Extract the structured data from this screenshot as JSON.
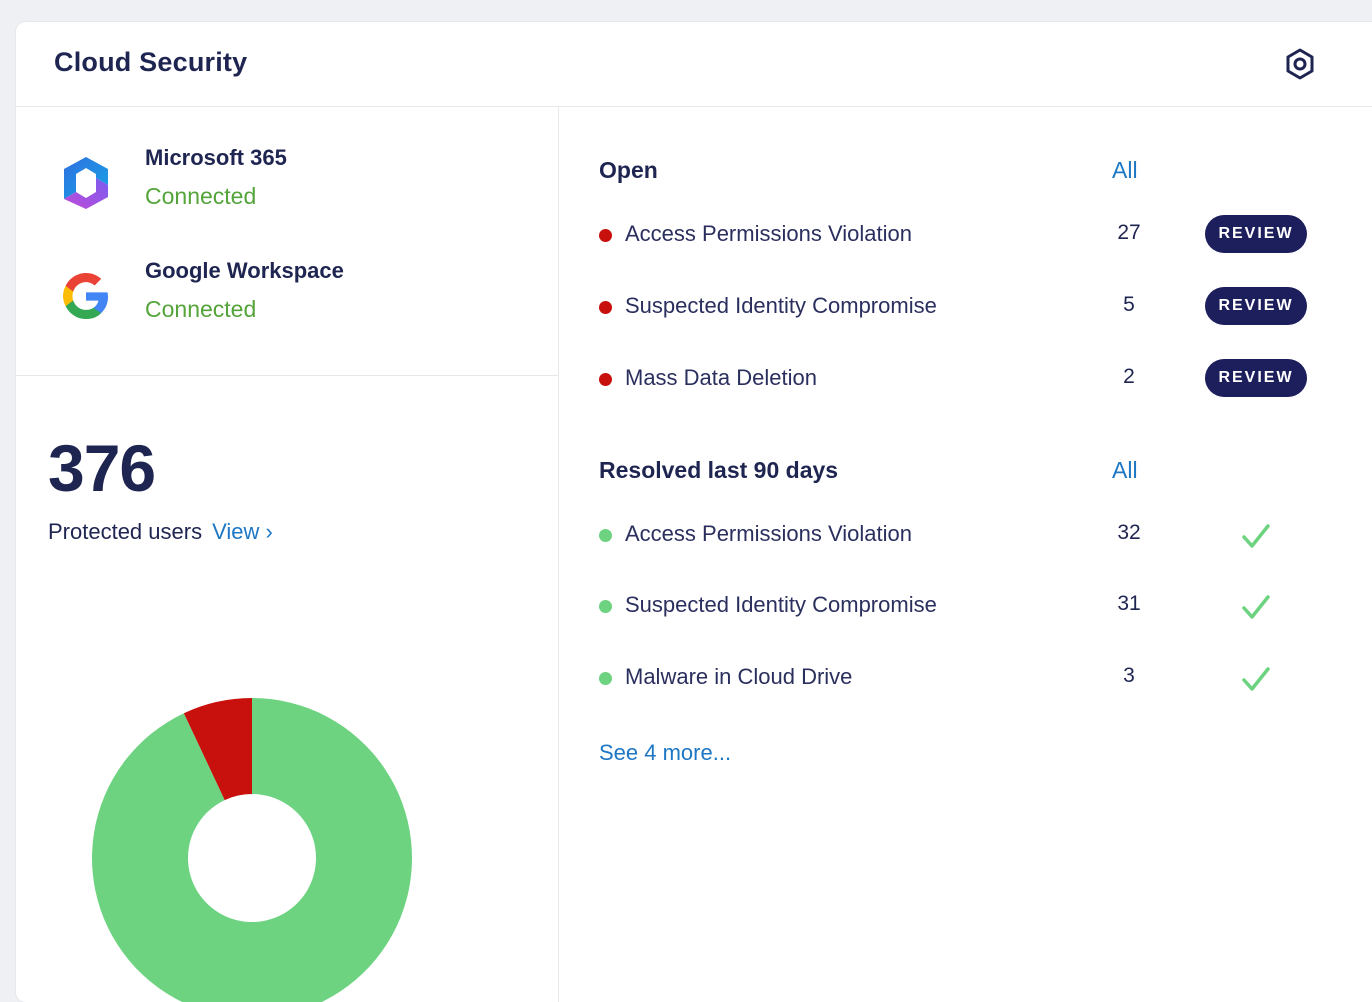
{
  "card": {
    "title": "Cloud Security",
    "settings_icon": "settings-hexagon-icon"
  },
  "integrations": [
    {
      "name": "Microsoft 365",
      "status": "Connected",
      "icon": "microsoft-365-logo"
    },
    {
      "name": "Google Workspace",
      "status": "Connected",
      "icon": "google-logo"
    }
  ],
  "protected": {
    "count": "376",
    "label": "Protected users",
    "view_label": "View ›"
  },
  "chart_data": {
    "type": "pie",
    "slices": [
      {
        "label": "",
        "value": 93,
        "color": "#6ed381"
      },
      {
        "label": "",
        "value": 7,
        "color": "#c8100c"
      }
    ]
  },
  "open": {
    "title": "Open",
    "all_label": "All",
    "items": [
      {
        "label": "Access Permissions Violation",
        "count": "27",
        "action": "REVIEW"
      },
      {
        "label": "Suspected Identity Compromise",
        "count": "5",
        "action": "REVIEW"
      },
      {
        "label": "Mass Data Deletion",
        "count": "2",
        "action": "REVIEW"
      }
    ]
  },
  "resolved": {
    "title": "Resolved last 90 days",
    "all_label": "All",
    "items": [
      {
        "label": "Access Permissions Violation",
        "count": "32"
      },
      {
        "label": "Suspected Identity Compromise",
        "count": "31"
      },
      {
        "label": "Malware in Cloud Drive",
        "count": "3"
      }
    ],
    "see_more": "See 4 more..."
  },
  "colors": {
    "navy": "#1f2551",
    "link": "#1d77c4",
    "connected": "#54a43a",
    "alert_red": "#c8100c",
    "ok_green": "#6ed381",
    "button_navy": "#1c1f5c"
  }
}
